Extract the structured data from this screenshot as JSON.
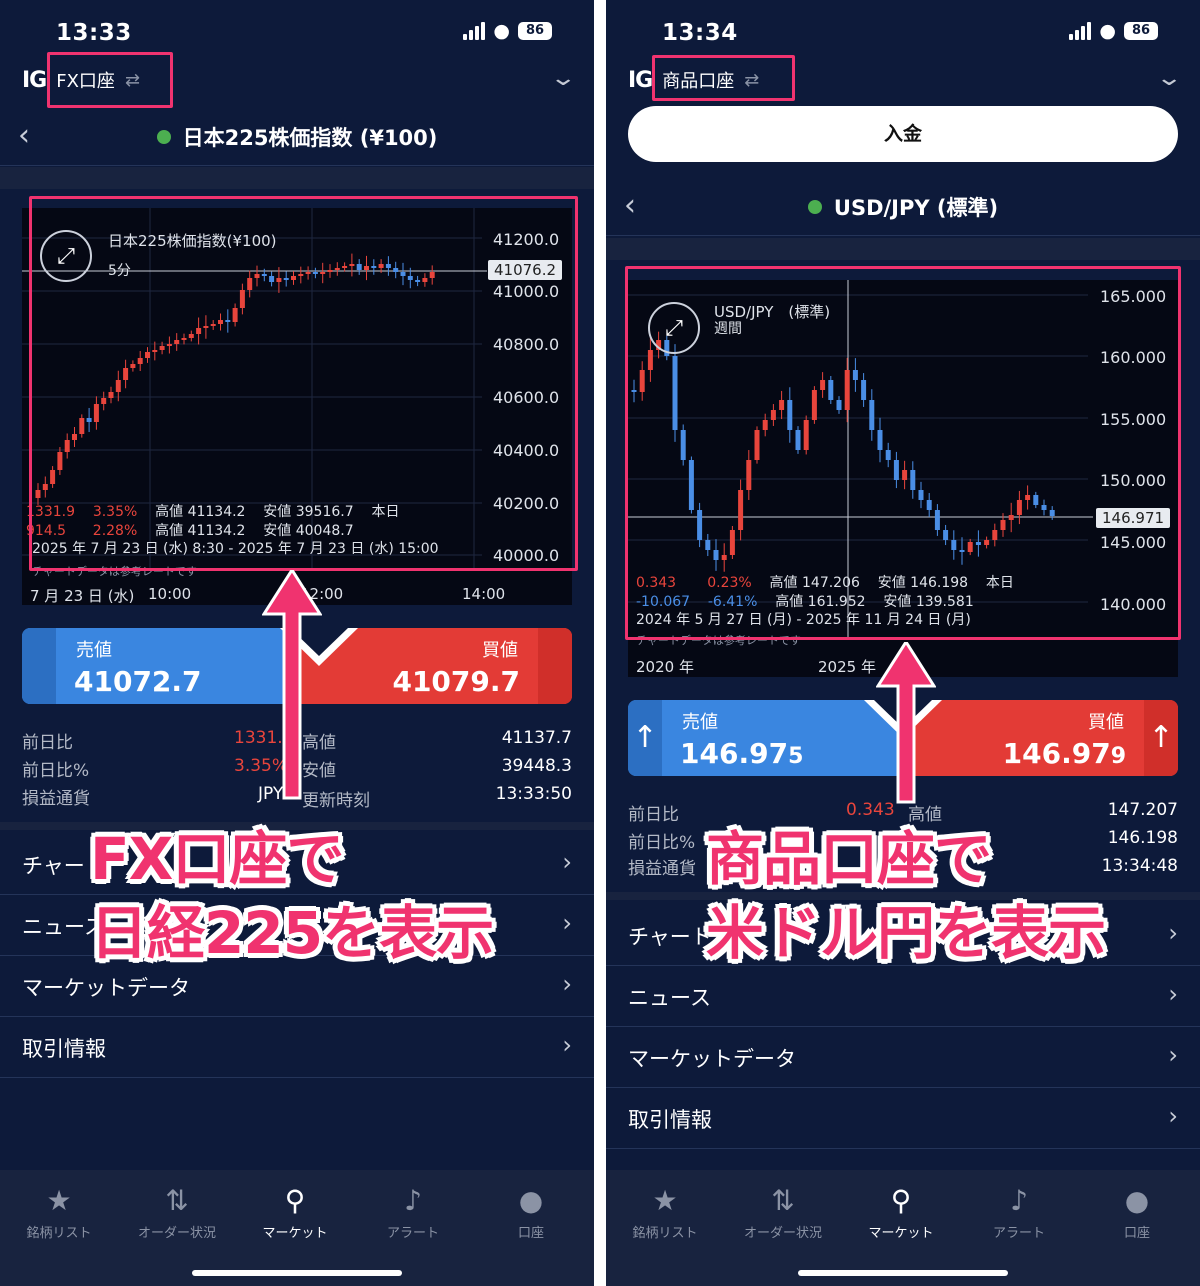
{
  "colors": {
    "bg": "#0d1a3a",
    "sell": "#3a86e0",
    "buy": "#e33b36",
    "highlight": "#f0336f",
    "up": "#e8453c",
    "down": "#4a8ee6"
  },
  "left": {
    "status": {
      "time": "13:33",
      "battery": "86"
    },
    "account": {
      "logo": "IG",
      "name": "FX口座"
    },
    "title": "日本225株価指数 (¥100)",
    "chart": {
      "name": "日本225株価指数(¥100)",
      "interval": "5分",
      "yticks": [
        "41200.0",
        "41000.0",
        "40800.0",
        "40600.0",
        "40400.0",
        "40200.0",
        "40000.0"
      ],
      "last": "41076.2",
      "info1": {
        "chg": "1331.9",
        "pct": "3.35%",
        "high_lbl": "高値",
        "high": "41134.2",
        "low_lbl": "安値",
        "low": "39516.7",
        "period": "本日"
      },
      "info2": {
        "chg": "914.5",
        "pct": "2.28%",
        "high_lbl": "高値",
        "high": "41134.2",
        "low_lbl": "安値",
        "low": "40048.7"
      },
      "range": "2025 年 7 月 23 日 (水) 8:30 - 2025 年 7 月 23 日 (水) 15:00",
      "note": "チャートデータは参考レートです",
      "xticks": [
        "7 月 23 日 (水)",
        "10:00",
        "12:00",
        "14:00"
      ]
    },
    "sell": {
      "label": "売値",
      "value": "41072.7"
    },
    "buy": {
      "label": "買値",
      "value": "41079.7"
    },
    "stats": [
      {
        "l": "前日比",
        "v": "1331.9",
        "l2": "高値",
        "v2": "41137.7"
      },
      {
        "l": "前日比%",
        "v": "3.35%",
        "l2": "安値",
        "v2": "39448.3"
      },
      {
        "l": "損益通貨",
        "v": "JPY",
        "l2": "更新時刻",
        "v2": "13:33:50"
      }
    ],
    "menu": [
      "チャート",
      "ニュース",
      "マーケットデータ",
      "取引情報"
    ],
    "overlay": [
      "FX口座で",
      "日経225を表示"
    ]
  },
  "right": {
    "status": {
      "time": "13:34",
      "battery": "86"
    },
    "account": {
      "logo": "IG",
      "name": "商品口座"
    },
    "deposit": "入金",
    "title": "USD/JPY (標準)",
    "chart": {
      "name": "USD/JPY　(標準)",
      "interval": "週間",
      "yticks": [
        "165.000",
        "160.000",
        "155.000",
        "150.000",
        "145.000",
        "140.000"
      ],
      "last": "146.971",
      "info1": {
        "chg": "0.343",
        "pct": "0.23%",
        "high_lbl": "高値",
        "high": "147.206",
        "low_lbl": "安値",
        "low": "146.198",
        "period": "本日"
      },
      "info2": {
        "chg": "-10.067",
        "pct": "-6.41%",
        "high_lbl": "高値",
        "high": "161.952",
        "low_lbl": "安値",
        "low": "139.581"
      },
      "range": "2024 年 5 月 27 日 (月) - 2025 年 11 月 24 日 (月)",
      "note": "チャートデータは参考レートです",
      "xticks": [
        "2020 年",
        "2025 年"
      ]
    },
    "sell": {
      "label": "売値",
      "value_main": "146.97",
      "value_sub": "5"
    },
    "buy": {
      "label": "買値",
      "value_main": "146.97",
      "value_sub": "9"
    },
    "stats": [
      {
        "l": "前日比",
        "v": "0.343",
        "l2": "高値",
        "v2": "147.207"
      },
      {
        "l": "前日比%",
        "v": "",
        "l2": "",
        "v2": "146.198"
      },
      {
        "l": "損益通貨",
        "v": "",
        "l2": "",
        "v2": "13:34:48"
      }
    ],
    "menu": [
      "チャート",
      "ニュース",
      "マーケットデータ",
      "取引情報"
    ],
    "overlay": [
      "商品口座で",
      "米ドル円を表示"
    ]
  },
  "tabs": [
    {
      "label": "銘柄リスト",
      "icon": "star-icon"
    },
    {
      "label": "オーダー状況",
      "icon": "orders-icon"
    },
    {
      "label": "マーケット",
      "icon": "search-icon"
    },
    {
      "label": "アラート",
      "icon": "bell-icon"
    },
    {
      "label": "口座",
      "icon": "account-icon"
    }
  ]
}
